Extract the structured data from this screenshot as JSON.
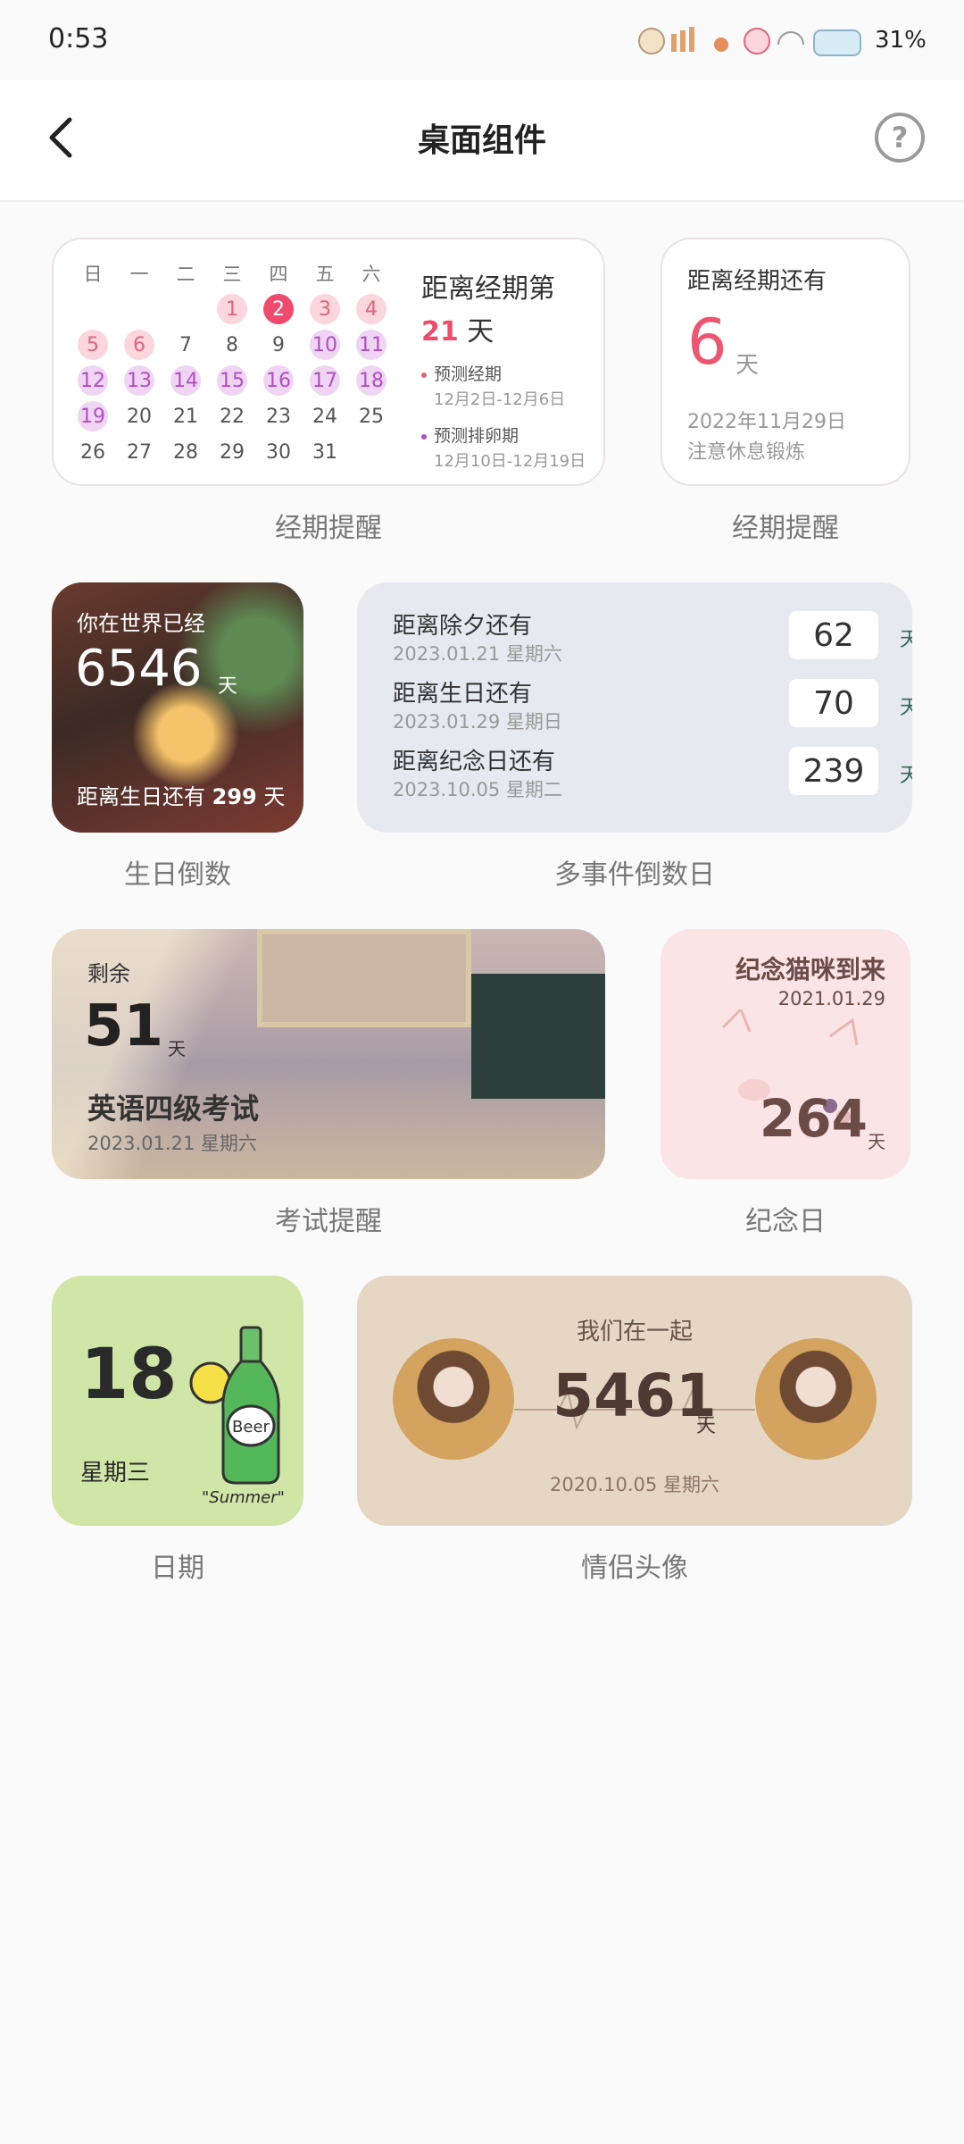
{
  "status": {
    "time": "0:53",
    "battery": "31%"
  },
  "header": {
    "title": "桌面组件",
    "help": "?"
  },
  "calendar": {
    "weekdays": [
      "日",
      "一",
      "二",
      "三",
      "四",
      "五",
      "六"
    ],
    "info_line1": "距离经期第",
    "info_num": "21",
    "info_unit": "天",
    "pred_period_label": "预测经期",
    "pred_period_dates": "12月2日-12月6日",
    "pred_ovul_label": "预测排卵期",
    "pred_ovul_dates": "12月10日-12月19日",
    "pink_color": "#e0637c",
    "purple_color": "#b04ec4",
    "caption": "经期提醒"
  },
  "period": {
    "title": "距离经期还有",
    "num": "6",
    "unit": "天",
    "date": "2022年11月29日",
    "tip": "注意休息锻炼",
    "caption": "经期提醒"
  },
  "birthday": {
    "line1": "你在世界已经",
    "num": "6546",
    "unit": "天",
    "bottom_prefix": "距离生日还有",
    "bottom_num": "299",
    "bottom_unit": "天",
    "caption": "生日倒数"
  },
  "multi": {
    "events": [
      {
        "name": "距离除夕还有",
        "date": "2023.01.21 星期六",
        "days": "62",
        "unit": "天"
      },
      {
        "name": "距离生日还有",
        "date": "2023.01.29 星期日",
        "days": "70",
        "unit": "天"
      },
      {
        "name": "距离纪念日还有",
        "date": "2023.10.05 星期二",
        "days": "239",
        "unit": "天"
      }
    ],
    "caption": "多事件倒数日"
  },
  "exam": {
    "label": "剩余",
    "num": "51",
    "unit": "天",
    "name": "英语四级考试",
    "date": "2023.01.21 星期六",
    "caption": "考试提醒"
  },
  "anniv": {
    "title": "纪念猫咪到来",
    "date": "2021.01.29",
    "num": "264",
    "unit": "天",
    "caption": "纪念日"
  },
  "date_widget": {
    "day": "18",
    "weekday": "星期三",
    "sticker": "\"Summer\"",
    "bottle": "Beer",
    "caption": "日期"
  },
  "couple": {
    "title": "我们在一起",
    "num": "5461",
    "unit": "天",
    "date": "2020.10.05 星期六",
    "caption": "情侣头像"
  }
}
